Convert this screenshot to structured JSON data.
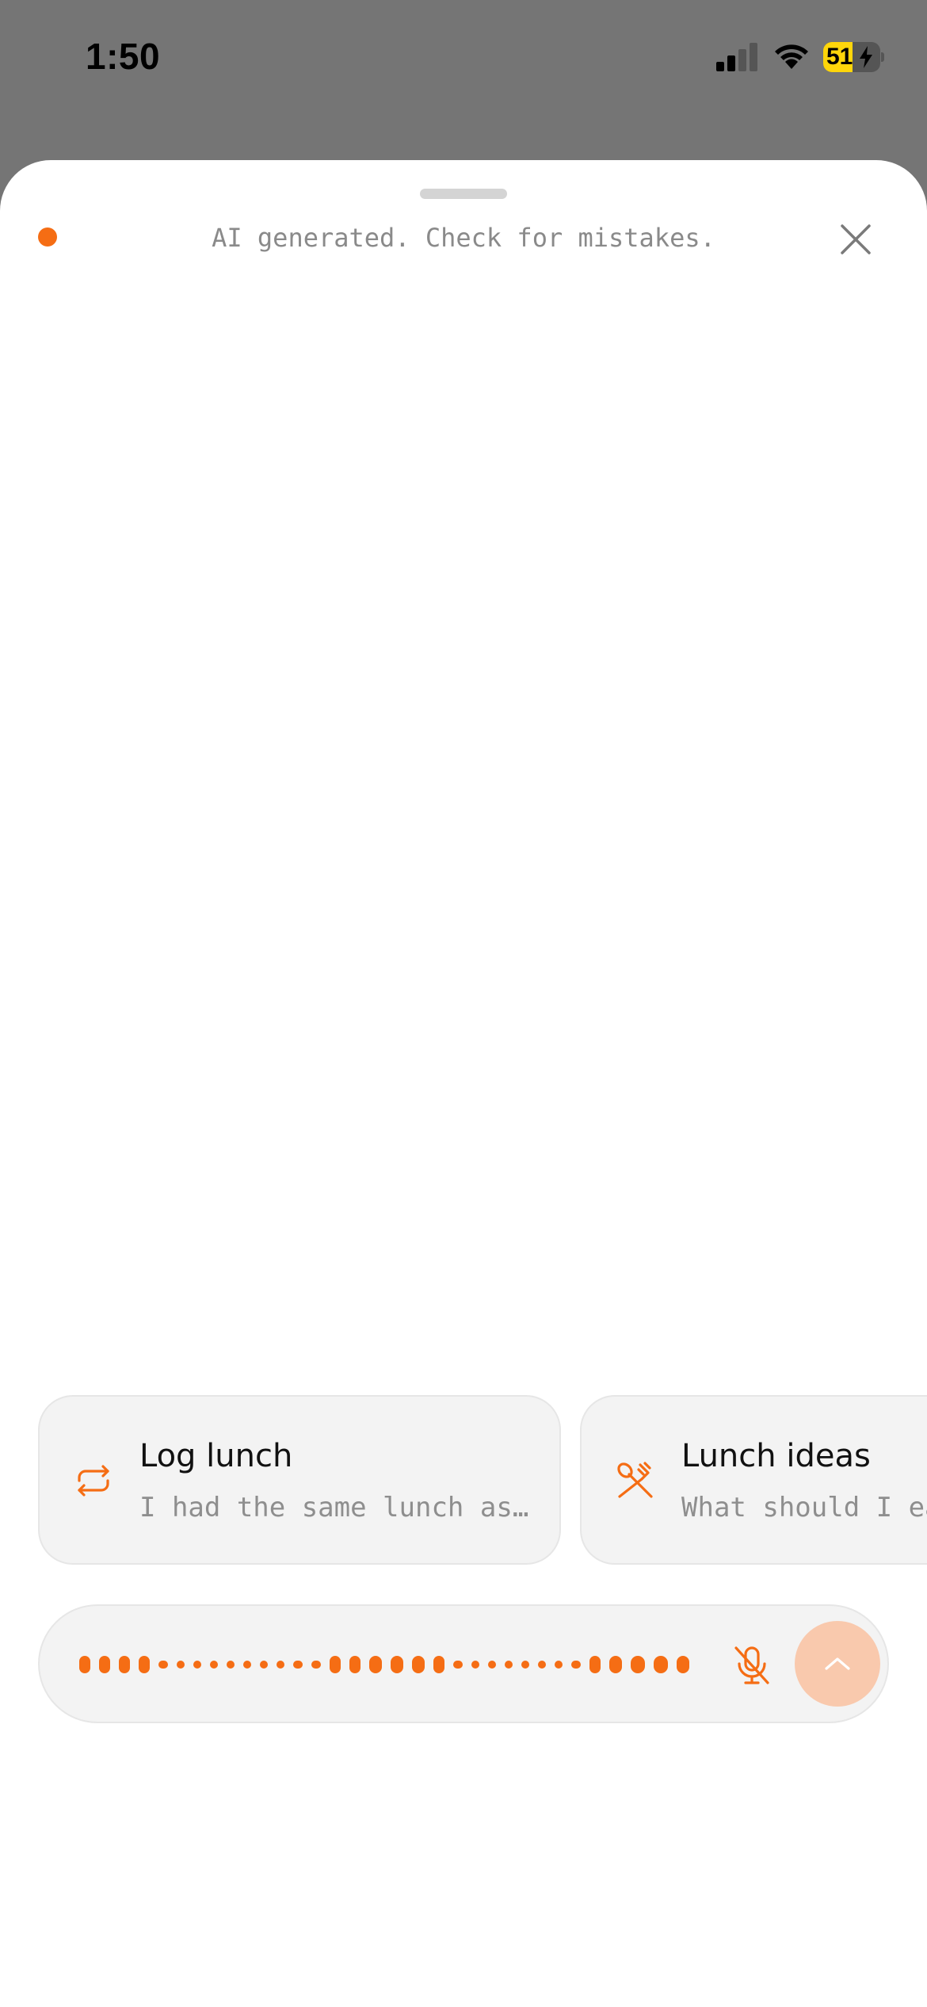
{
  "status_bar": {
    "time": "1:50",
    "battery_level": "51",
    "battery_percent": 51,
    "signal_icon": "cellular-signal-icon",
    "wifi_icon": "wifi-icon",
    "battery_icon": "battery-charging-icon"
  },
  "sheet": {
    "disclaimer": "AI generated. Check for mistakes.",
    "close_icon": "close-icon",
    "status_dot_color": "#f56d14"
  },
  "suggestions": [
    {
      "icon": "repeat-icon",
      "title": "Log lunch",
      "subtitle": "I had the same lunch as y..."
    },
    {
      "icon": "utensils-icon",
      "title": "Lunch ideas",
      "subtitle": "What should I eat"
    }
  ],
  "input": {
    "state": "recording",
    "mic_icon": "mic-off-icon",
    "send_icon": "chevron-up-icon"
  },
  "colors": {
    "accent": "#f56d14",
    "send_button": "#f9c9ad",
    "backdrop": "#757575"
  }
}
